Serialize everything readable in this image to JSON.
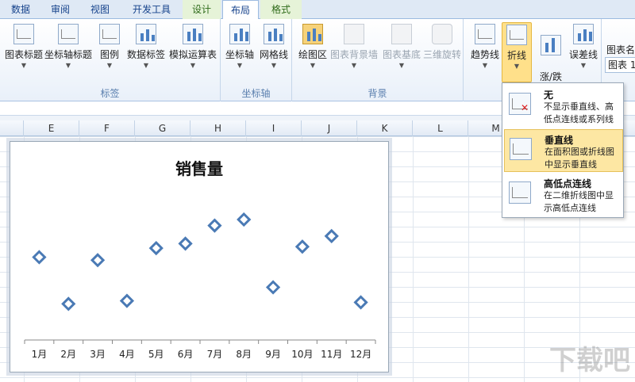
{
  "tabs": [
    {
      "label": "数据"
    },
    {
      "label": "审阅"
    },
    {
      "label": "视图"
    },
    {
      "label": "开发工具"
    },
    {
      "label": "设计"
    },
    {
      "label": "布局"
    },
    {
      "label": "格式"
    }
  ],
  "ribbon": {
    "groups": {
      "labels": {
        "name": "标签",
        "buttons": [
          "图表标题",
          "坐标轴标题",
          "图例",
          "数据标签",
          "模拟运算表"
        ]
      },
      "axes": {
        "name": "坐标轴",
        "buttons": [
          "坐标轴",
          "网格线"
        ]
      },
      "background": {
        "name": "背景",
        "buttons": [
          "绘图区",
          "图表背景墙",
          "图表基底",
          "三维旋转"
        ]
      },
      "analysis": {
        "buttons": [
          "趋势线",
          "折线",
          "涨/跌\n柱线",
          "误差线"
        ]
      }
    },
    "right_panel": {
      "label": "图表名称",
      "value": "图表 1"
    }
  },
  "columns": [
    "E",
    "F",
    "G",
    "H",
    "I",
    "J",
    "K",
    "L",
    "M"
  ],
  "dropdown": {
    "items": [
      {
        "title": "无",
        "desc": "不显示垂直线、高低点连线或系列线"
      },
      {
        "title": "垂直线",
        "desc": "在面积图或折线图中显示垂直线"
      },
      {
        "title": "高低点连线",
        "desc": "在二维折线图中显示高低点连线"
      }
    ]
  },
  "chart_data": {
    "type": "scatter",
    "title": "销售量",
    "categories": [
      "1月",
      "2月",
      "3月",
      "4月",
      "5月",
      "6月",
      "7月",
      "8月",
      "9月",
      "10月",
      "11月",
      "12月"
    ],
    "values": [
      55,
      24,
      53,
      26,
      61,
      64,
      76,
      80,
      35,
      62,
      69,
      25
    ],
    "ylim": [
      0,
      100
    ],
    "marker": "diamond",
    "color": "#4a7ab5"
  },
  "watermark": "下载吧"
}
